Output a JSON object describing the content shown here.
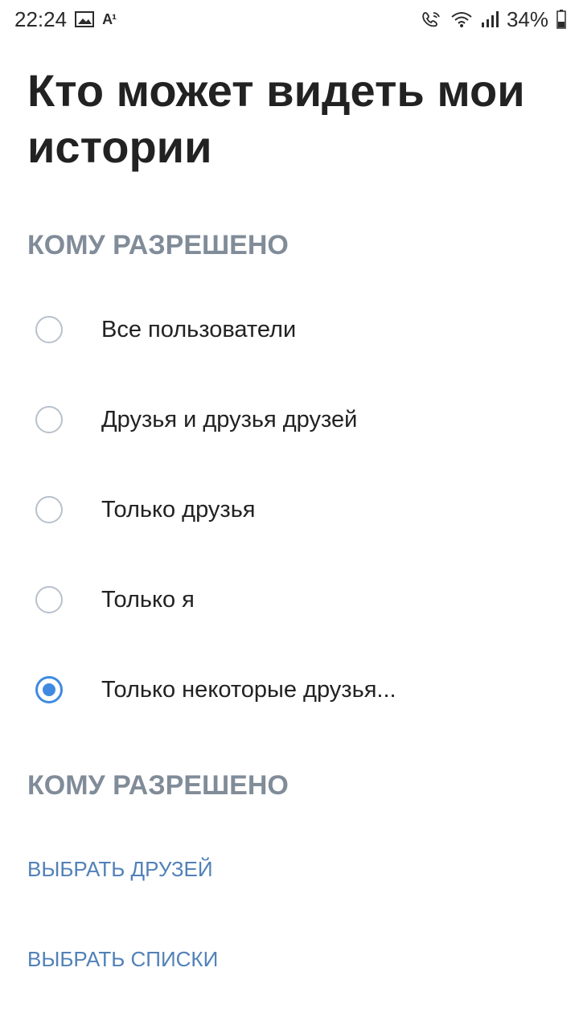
{
  "status_bar": {
    "time": "22:24",
    "carrier_badge": "A¹",
    "battery": "34%"
  },
  "title": "Кто может видеть мои истории",
  "section1": {
    "header": "КОМУ РАЗРЕШЕНО"
  },
  "options": [
    {
      "label": "Все пользователи",
      "selected": false
    },
    {
      "label": "Друзья и друзья друзей",
      "selected": false
    },
    {
      "label": "Только друзья",
      "selected": false
    },
    {
      "label": "Только я",
      "selected": false
    },
    {
      "label": "Только некоторые друзья...",
      "selected": true
    }
  ],
  "section2": {
    "header": "КОМУ РАЗРЕШЕНО"
  },
  "links": {
    "choose_friends": "ВЫБРАТЬ ДРУЗЕЙ",
    "choose_lists": "ВЫБРАТЬ СПИСКИ"
  },
  "colors": {
    "accent": "#3f8ae0",
    "link": "#5181b8",
    "section_header": "#818c99",
    "radio_border": "#b8c1cc"
  },
  "icons": [
    "gallery-icon",
    "wifi-calling-icon",
    "wifi-icon",
    "signal-icon",
    "battery-icon"
  ]
}
